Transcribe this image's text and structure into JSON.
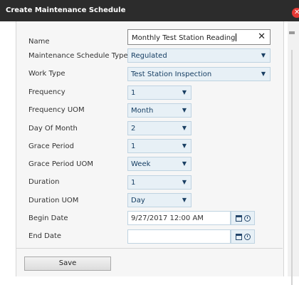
{
  "dialog": {
    "title": "Create Maintenance Schedule",
    "close_glyph": "✕"
  },
  "form": {
    "name": {
      "label": "Name",
      "value": "Monthly Test Station Reading",
      "clear_glyph": "✕"
    },
    "schedule_type": {
      "label": "Maintenance Schedule Type",
      "value": "Regulated"
    },
    "work_type": {
      "label": "Work Type",
      "value": "Test Station Inspection"
    },
    "frequency": {
      "label": "Frequency",
      "value": "1"
    },
    "frequency_uom": {
      "label": "Frequency UOM",
      "value": "Month"
    },
    "day_of_month": {
      "label": "Day Of Month",
      "value": "2"
    },
    "grace_period": {
      "label": "Grace Period",
      "value": "1"
    },
    "grace_period_uom": {
      "label": "Grace Period UOM",
      "value": "Week"
    },
    "duration": {
      "label": "Duration",
      "value": "1"
    },
    "duration_uom": {
      "label": "Duration UOM",
      "value": "Day"
    },
    "begin_date": {
      "label": "Begin Date",
      "value": "9/27/2017 12:00 AM"
    },
    "end_date": {
      "label": "End Date",
      "value": ""
    }
  },
  "actions": {
    "save_label": "Save"
  },
  "icons": {
    "dropdown": "chevron-down-icon",
    "calendar": "calendar-icon",
    "clock": "clock-icon"
  },
  "colors": {
    "title_bar": "#2c2c2c",
    "field_bg": "#e7f0f6",
    "field_text": "#163e63",
    "close": "#e53935"
  }
}
